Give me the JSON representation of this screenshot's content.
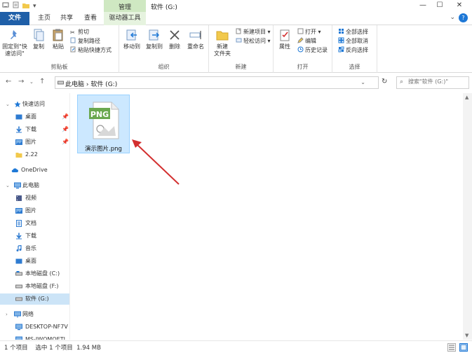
{
  "window": {
    "title": "软件 (G:)",
    "manage_label": "管理",
    "minimize": "—",
    "maximize": "☐",
    "close": "✕"
  },
  "tabs": {
    "file": "文件",
    "home": "主页",
    "share": "共享",
    "view": "查看",
    "drive_tools": "驱动器工具"
  },
  "ribbon": {
    "clipboard": {
      "label": "剪贴板",
      "pin": "固定到\"快速访问\"",
      "copy": "复制",
      "paste": "粘贴",
      "cut": "剪切",
      "copy_path": "复制路径",
      "paste_shortcut": "粘贴快捷方式"
    },
    "organize": {
      "label": "组织",
      "move_to": "移动到",
      "copy_to": "复制到",
      "delete": "删除",
      "rename": "重命名"
    },
    "new": {
      "label": "新建",
      "new_folder": "新建\n文件夹",
      "new_item": "新建项目",
      "easy_access": "轻松访问"
    },
    "open": {
      "label": "打开",
      "properties": "属性",
      "open": "打开",
      "edit": "编辑",
      "history": "历史记录"
    },
    "select": {
      "label": "选择",
      "select_all": "全部选择",
      "select_none": "全部取消",
      "invert": "反向选择"
    }
  },
  "address": {
    "crumbs": "此电脑  ›  软件 (G:)",
    "search_placeholder": "搜索\"软件 (G:)\""
  },
  "nav": {
    "quick_access": "快速访问",
    "desktop": "桌面",
    "downloads": "下载",
    "pictures": "图片",
    "folder_222": "2.22",
    "onedrive": "OneDrive",
    "this_pc": "此电脑",
    "videos": "视频",
    "pictures2": "图片",
    "documents": "文档",
    "downloads2": "下载",
    "music": "音乐",
    "desktop2": "桌面",
    "disk_c": "本地磁盘 (C:)",
    "disk_f": "本地磁盘 (F:)",
    "software_g": "软件 (G:)",
    "network": "网络",
    "desktop_pc": "DESKTOP-NF7V",
    "ms_pc": "MS-IWOMOETI"
  },
  "files": [
    {
      "name": "演示图片.png",
      "badge": "PNG"
    }
  ],
  "status": {
    "text": "1 个项目    选中 1 个项目  1.94 MB"
  },
  "colors": {
    "file_tab": "#1f5fa8",
    "manage_tab": "#cfe8c2",
    "selection": "#cce8ff",
    "png_badge": "#6aa84f",
    "arrow": "#d32f2f"
  }
}
